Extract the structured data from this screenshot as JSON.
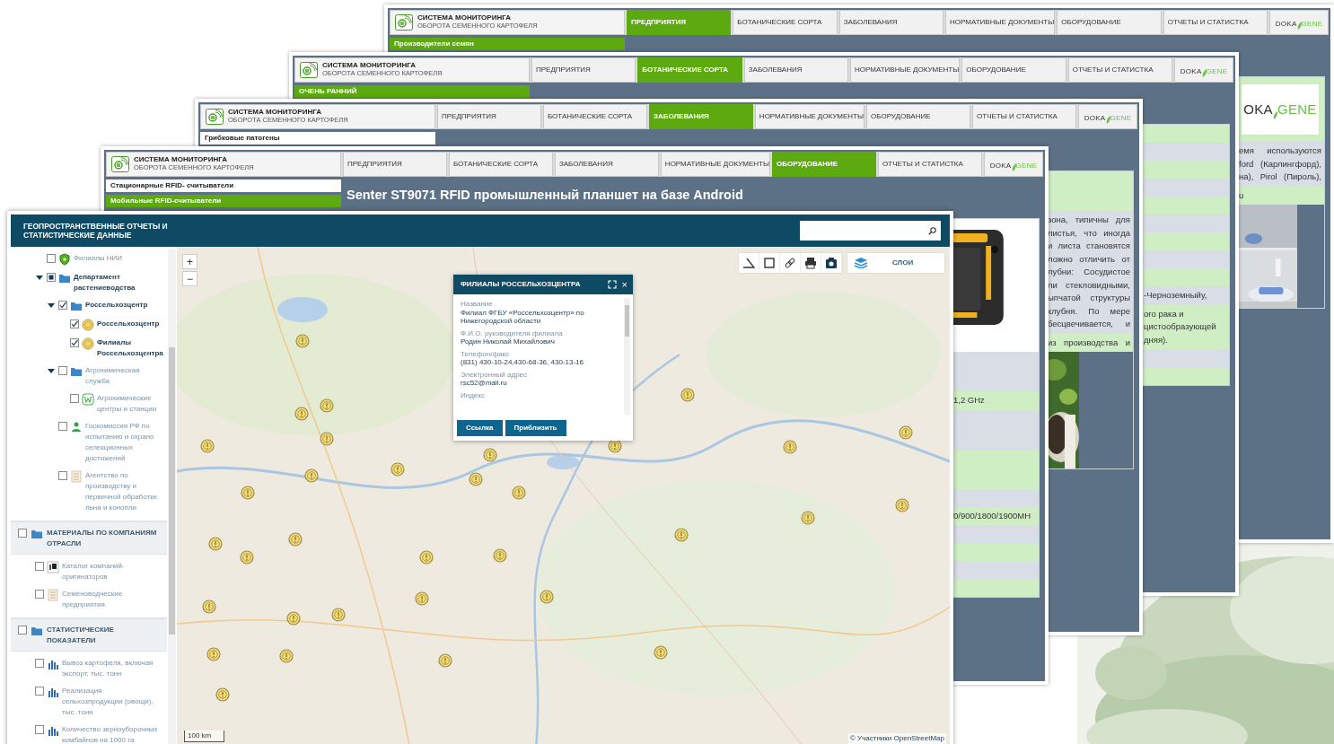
{
  "back_windows": [
    {
      "app_title": "СИСТЕМА МОНИТОРИНГА",
      "app_subtitle": "ОБОРОТА СЕМЕННОГО КАРТОФЕЛЯ",
      "tabs": [
        {
          "label": "ПРЕДПРИЯТИЯ",
          "selected": true
        },
        {
          "label": "БОТАНИЧЕСКИЕ СОРТА",
          "selected": false
        },
        {
          "label": "ЗАБОЛЕВАНИЯ",
          "selected": false
        },
        {
          "label": "НОРМАТИВНЫЕ ДОКУМЕНТЫ",
          "selected": false
        },
        {
          "label": "ОБОРУДОВАНИЕ",
          "selected": false
        },
        {
          "label": "ОТЧЕТЫ И СТАТИСТКА",
          "selected": false
        }
      ],
      "brand": {
        "left": "DOKA",
        "right": "GENE"
      },
      "side_menu": [
        {
          "label": "Производители семян",
          "selected": true
        }
      ],
      "panel": [
        {
          "kind": "logo",
          "left": "OKA",
          "right": "GENE"
        },
        {
          "kind": "grey",
          "justify": true,
          "lines": [
            "емя используются",
            "ford (Карлингфорд),",
            "на), Pirol (Пироль),"
          ]
        },
        {
          "kind": "green",
          "lines": [
            "u"
          ]
        },
        {
          "kind": "picture"
        }
      ]
    },
    {
      "app_title": "СИСТЕМА МОНИТОРИНГА",
      "app_subtitle": "ОБОРОТА СЕМЕННОГО КАРТОФЕЛЯ",
      "tabs": [
        {
          "label": "ПРЕДПРИЯТИЯ",
          "selected": false
        },
        {
          "label": "БОТАНИЧЕСКИЕ СОРТА",
          "selected": true
        },
        {
          "label": "ЗАБОЛЕВАНИЯ",
          "selected": false
        },
        {
          "label": "НОРМАТИВНЫЕ ДОКУМЕНТЫ",
          "selected": false
        },
        {
          "label": "ОБОРУДОВАНИЕ",
          "selected": false
        },
        {
          "label": "ОТЧЕТЫ И СТАТИСТКА",
          "selected": false
        }
      ],
      "brand": {
        "left": "DOKA",
        "right": "GENE"
      },
      "side_menu": [
        {
          "label": "ОЧЕНЬ РАННИЙ",
          "selected": true
        }
      ],
      "panel": [
        {
          "kind": "green"
        },
        {
          "kind": "grey"
        },
        {
          "kind": "green"
        },
        {
          "kind": "grey"
        },
        {
          "kind": "green"
        },
        {
          "kind": "grey"
        },
        {
          "kind": "green"
        },
        {
          "kind": "grey"
        },
        {
          "kind": "green"
        },
        {
          "kind": "grey",
          "lines": [
            "-Черноземныйу,"
          ]
        },
        {
          "kind": "green",
          "lines": [
            "ого рака и",
            "цистообразующей",
            "дняя)."
          ]
        },
        {
          "kind": "grey"
        },
        {
          "kind": "green"
        }
      ]
    },
    {
      "app_title": "СИСТЕМА МОНИТОРИНГА",
      "app_subtitle": "ОБОРОТА СЕМЕННОГО КАРТОФЕЛЯ",
      "tabs": [
        {
          "label": "ПРЕДПРИЯТИЯ",
          "selected": false
        },
        {
          "label": "БОТАНИЧЕСКИЕ СОРТА",
          "selected": false
        },
        {
          "label": "ЗАБОЛЕВАНИЯ",
          "selected": true
        },
        {
          "label": "НОРМАТИВНЫЕ ДОКУМЕНТЫ",
          "selected": false
        },
        {
          "label": "ОБОРУДОВАНИЕ",
          "selected": false
        },
        {
          "label": "ОТЧЕТЫ И СТАТИСТКА",
          "selected": false
        }
      ],
      "brand": {
        "left": "DOKA",
        "right": "GENE"
      },
      "side_menu": [
        {
          "label": "Грибковые патогены",
          "selected": false
        }
      ],
      "panel": [
        {
          "kind": "green",
          "tall": true
        },
        {
          "kind": "grey",
          "justify": true,
          "lines": [
            "зона, типичны для",
            "листья, что иногда",
            "и листа становятся",
            "ложно отличить от",
            "лубни: Сосудистое",
            "ли стекловидными,",
            "ыпчатой структуры",
            "клубня. По мере",
            "бесцвечивается, и"
          ]
        },
        {
          "kind": "green",
          "justify": true,
          "lines": [
            "из производства и"
          ]
        },
        {
          "kind": "picture"
        }
      ]
    },
    {
      "app_title": "СИСТЕМА МОНИТОРИНГА",
      "app_subtitle": "ОБОРОТА СЕМЕННОГО КАРТОФЕЛЯ",
      "tabs": [
        {
          "label": "ПРЕДПРИЯТИЯ",
          "selected": false
        },
        {
          "label": "БОТАНИЧЕСКИЕ СОРТА",
          "selected": false
        },
        {
          "label": "ЗАБОЛЕВАНИЯ",
          "selected": false
        },
        {
          "label": "НОРМАТИВНЫЕ ДОКУМЕНТЫ",
          "selected": false
        },
        {
          "label": "ОБОРУДОВАНИЕ",
          "selected": true
        },
        {
          "label": "ОТЧЕТЫ И СТАТИСТКА",
          "selected": false
        }
      ],
      "brand": {
        "left": "DOKA",
        "right": "GENE"
      },
      "side_menu": [
        {
          "label": "Стационарные RFID- считыватели",
          "selected": false
        },
        {
          "label": "Мобильные RFID-считыватели",
          "selected": true
        }
      ],
      "heading": "Senter ST9071 RFID промышленный планшет на базе Android",
      "panel": [
        {
          "kind": "picture"
        },
        {
          "kind": "grey",
          "tall": true
        },
        {
          "kind": "green",
          "lines": [
            "1,2 GHz"
          ]
        },
        {
          "kind": "grey",
          "tall": true
        },
        {
          "kind": "green",
          "tall": true
        },
        {
          "kind": "grey"
        },
        {
          "kind": "green",
          "lines": [
            "0/900/1800/1900MH"
          ]
        },
        {
          "kind": "grey"
        },
        {
          "kind": "green"
        },
        {
          "kind": "grey"
        },
        {
          "kind": "green"
        }
      ]
    }
  ],
  "map_app": {
    "title": "ГЕОПРОСТРАНСТВЕННЫЕ ОТЧЕТЫ И СТАТИСТИЧЕСКИЕ ДАННЫЕ",
    "layers": [
      {
        "items": [
          {
            "kind": "shield",
            "label": "Филиалы НИИ",
            "checked": false,
            "indeterminate": false
          },
          {
            "kind": "folder",
            "label": "Департамент растениеводства",
            "checked": false,
            "indeterminate": true,
            "expanded": true,
            "children": [
              {
                "kind": "folder",
                "label": "Россельхозцентр",
                "checked": true,
                "indeterminate": false,
                "expanded": true,
                "children": [
                  {
                    "kind": "marker",
                    "label": "Россельхозцентр",
                    "checked": true,
                    "indeterminate": false
                  },
                  {
                    "kind": "marker",
                    "label": "Филиалы Россельхозцентра",
                    "checked": true,
                    "indeterminate": false
                  }
                ]
              },
              {
                "kind": "folder",
                "label": "Агрохимическая служба",
                "checked": false,
                "indeterminate": false,
                "expanded": true,
                "children": [
                  {
                    "kind": "station",
                    "label": "Агрохимические центры и станции",
                    "checked": false,
                    "indeterminate": false
                  }
                ]
              },
              {
                "kind": "person",
                "label": "Госкомиссия РФ по испытанию и охрано селекционных достижений",
                "checked": false,
                "indeterminate": false
              },
              {
                "kind": "document",
                "label": "Агентство по производству и первичной обработке льна и конопли",
                "checked": false,
                "indeterminate": false
              }
            ]
          }
        ]
      },
      {
        "title": "МАТЕРИАЛЫ ПО КОМПАНИЯМ ОТРАСЛИ",
        "checked": false,
        "items": [
          {
            "kind": "catalog",
            "label": "Каталог компаний-оригинаторов",
            "checked": false,
            "indeterminate": false
          },
          {
            "kind": "document",
            "label": "Семеноводческие предприятия",
            "checked": false,
            "indeterminate": false
          }
        ]
      },
      {
        "title": "СТАТИСТИЧЕСКИЕ ПОКАЗАТЕЛИ",
        "checked": false,
        "items": [
          {
            "kind": "chart",
            "label": "Вывоз картофеля, включая экспорт, тыс. тонн",
            "checked": false,
            "indeterminate": false
          },
          {
            "kind": "chart",
            "label": "Реализация сельхозпродукции (овощи), тыс. тонн",
            "checked": false,
            "indeterminate": false
          },
          {
            "kind": "chart",
            "label": "Количество зерноуборочных комбайнов на 1000 га",
            "checked": false,
            "indeterminate": false
          }
        ]
      }
    ],
    "zoom_in": "+",
    "zoom_out": "−",
    "layers_label": "СЛОИ",
    "popup": {
      "title": "ФИЛИАЛЫ РОССЕЛЬХОЗЦЕНТРА",
      "close": "×",
      "fields": [
        {
          "label": "Название",
          "value": "Филиал ФГБУ «Россельхозцентр» по Нижегородской области"
        },
        {
          "label": "Ф.И.О. руководителя филиала",
          "value": "Родин Николай Михайлович"
        },
        {
          "label": "Телефон/факс",
          "value": "(831) 430-10-24,430-68-36, 430-13-16"
        },
        {
          "label": "Электронный адрес",
          "value": "rsc52@mail.ru"
        },
        {
          "label": "Индекс"
        }
      ],
      "buttons": [
        "Ссылка",
        "Приблизить"
      ]
    },
    "scale": "100 km",
    "attribution": "© Участники OpenStreetMap"
  }
}
